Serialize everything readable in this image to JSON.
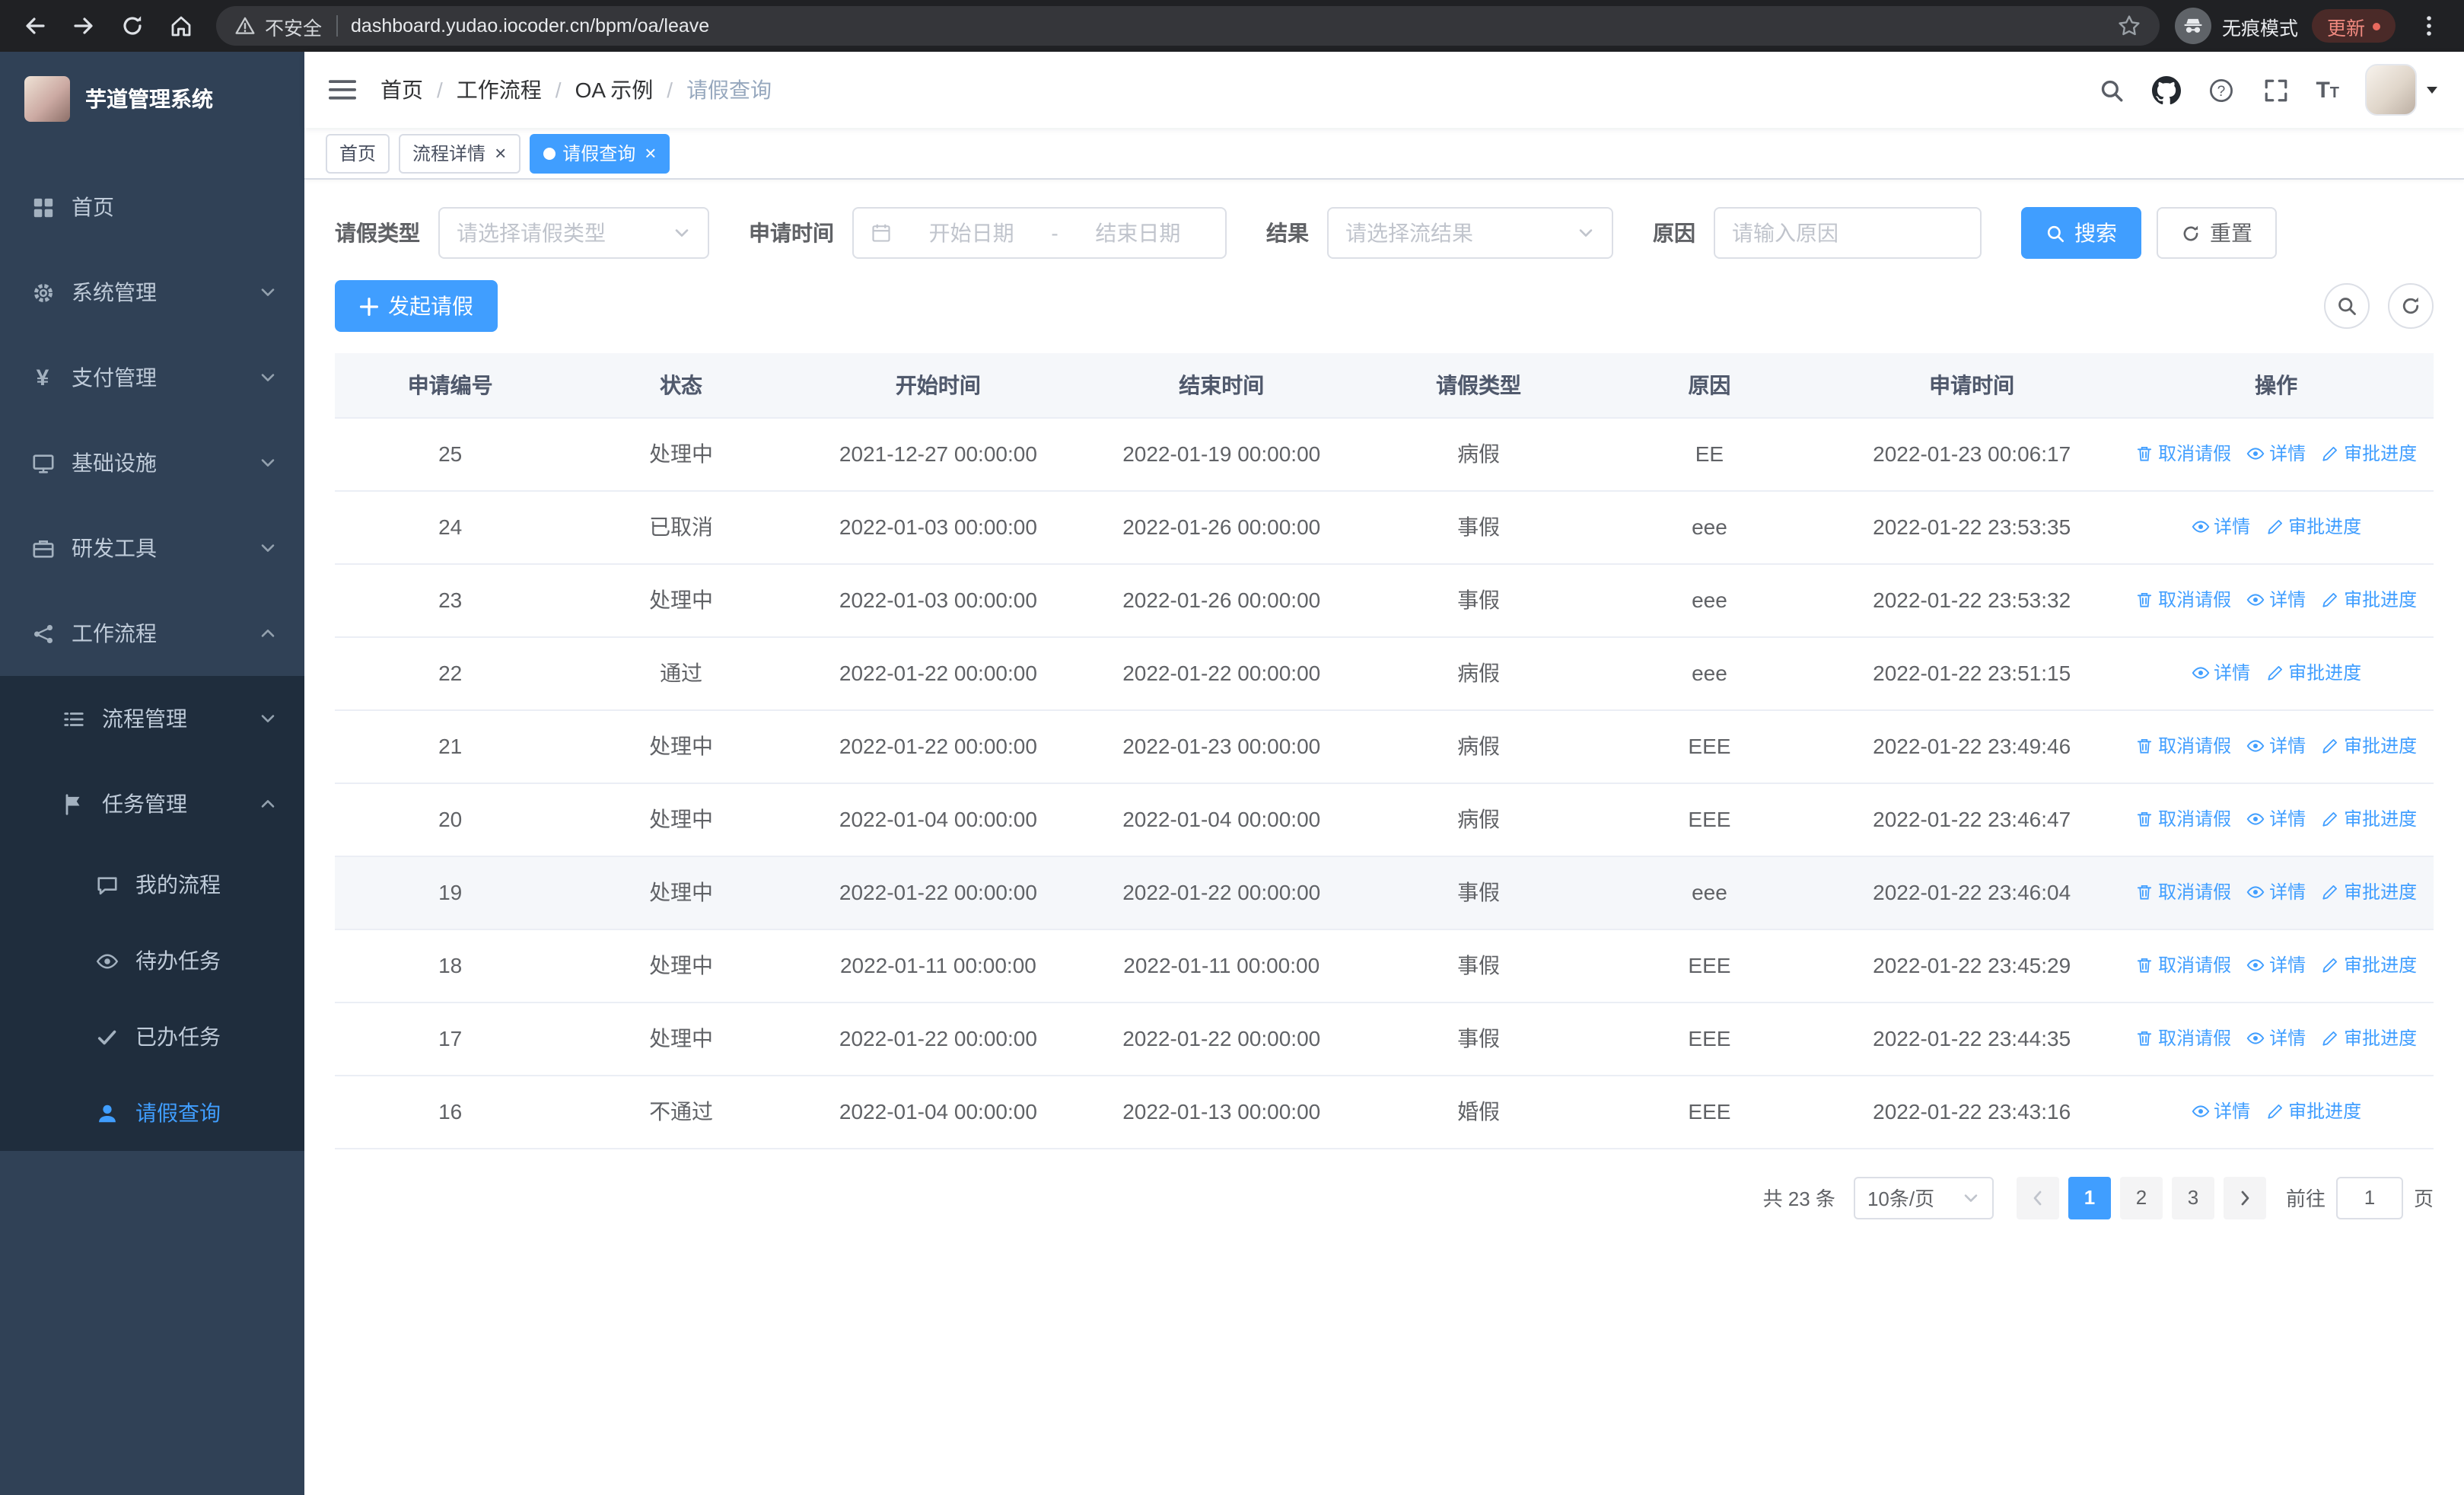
{
  "browser": {
    "security_label": "不安全",
    "url": "dashboard.yudao.iocoder.cn/bpm/oa/leave",
    "incognito_label": "无痕模式",
    "update_label": "更新"
  },
  "sidebar": {
    "logo_title": "芋道管理系统",
    "menu": [
      {
        "label": "首页",
        "icon": "dashboard",
        "level": 1
      },
      {
        "label": "系统管理",
        "icon": "gear",
        "level": 1,
        "arrow": "down"
      },
      {
        "label": "支付管理",
        "icon": "yen",
        "level": 1,
        "arrow": "down"
      },
      {
        "label": "基础设施",
        "icon": "monitor",
        "level": 1,
        "arrow": "down"
      },
      {
        "label": "研发工具",
        "icon": "tools",
        "level": 1,
        "arrow": "down"
      },
      {
        "label": "工作流程",
        "icon": "workflow",
        "level": 1,
        "arrow": "up"
      },
      {
        "label": "流程管理",
        "icon": "list",
        "level": 2,
        "arrow": "down"
      },
      {
        "label": "任务管理",
        "icon": "task",
        "level": 2,
        "arrow": "up"
      },
      {
        "label": "我的流程",
        "icon": "chat",
        "level": 3
      },
      {
        "label": "待办任务",
        "icon": "eye",
        "level": 3
      },
      {
        "label": "已办任务",
        "icon": "done",
        "level": 3
      },
      {
        "label": "请假查询",
        "icon": "user",
        "level": 3,
        "active": true
      }
    ]
  },
  "header": {
    "breadcrumb": [
      "首页",
      "工作流程",
      "OA 示例",
      "请假查询"
    ]
  },
  "tabs": [
    {
      "label": "首页",
      "closable": false,
      "active": false
    },
    {
      "label": "流程详情",
      "closable": true,
      "active": false
    },
    {
      "label": "请假查询",
      "closable": true,
      "active": true
    }
  ],
  "filters": {
    "leave_type_label": "请假类型",
    "leave_type_placeholder": "请选择请假类型",
    "apply_time_label": "申请时间",
    "date_start_placeholder": "开始日期",
    "date_separator": "-",
    "date_end_placeholder": "结束日期",
    "result_label": "结果",
    "result_placeholder": "请选择流结果",
    "reason_label": "原因",
    "reason_placeholder": "请输入原因",
    "search_label": "搜索",
    "reset_label": "重置"
  },
  "toolbar": {
    "create_label": "发起请假"
  },
  "table": {
    "headers": [
      "申请编号",
      "状态",
      "开始时间",
      "结束时间",
      "请假类型",
      "原因",
      "申请时间",
      "操作"
    ],
    "action_labels": {
      "cancel": "取消请假",
      "detail": "详情",
      "progress": "审批进度"
    },
    "rows": [
      {
        "id": "25",
        "status": "处理中",
        "start_time": "2021-12-27 00:00:00",
        "end_time": "2022-01-19 00:00:00",
        "leave_type": "病假",
        "reason": "EE",
        "apply_time": "2022-01-23 00:06:17",
        "ops": [
          "cancel",
          "detail",
          "progress"
        ]
      },
      {
        "id": "24",
        "status": "已取消",
        "start_time": "2022-01-03 00:00:00",
        "end_time": "2022-01-26 00:00:00",
        "leave_type": "事假",
        "reason": "eee",
        "apply_time": "2022-01-22 23:53:35",
        "ops": [
          "detail",
          "progress"
        ]
      },
      {
        "id": "23",
        "status": "处理中",
        "start_time": "2022-01-03 00:00:00",
        "end_time": "2022-01-26 00:00:00",
        "leave_type": "事假",
        "reason": "eee",
        "apply_time": "2022-01-22 23:53:32",
        "ops": [
          "cancel",
          "detail",
          "progress"
        ]
      },
      {
        "id": "22",
        "status": "通过",
        "start_time": "2022-01-22 00:00:00",
        "end_time": "2022-01-22 00:00:00",
        "leave_type": "病假",
        "reason": "eee",
        "apply_time": "2022-01-22 23:51:15",
        "ops": [
          "detail",
          "progress"
        ]
      },
      {
        "id": "21",
        "status": "处理中",
        "start_time": "2022-01-22 00:00:00",
        "end_time": "2022-01-23 00:00:00",
        "leave_type": "病假",
        "reason": "EEE",
        "apply_time": "2022-01-22 23:49:46",
        "ops": [
          "cancel",
          "detail",
          "progress"
        ]
      },
      {
        "id": "20",
        "status": "处理中",
        "start_time": "2022-01-04 00:00:00",
        "end_time": "2022-01-04 00:00:00",
        "leave_type": "病假",
        "reason": "EEE",
        "apply_time": "2022-01-22 23:46:47",
        "ops": [
          "cancel",
          "detail",
          "progress"
        ]
      },
      {
        "id": "19",
        "status": "处理中",
        "start_time": "2022-01-22 00:00:00",
        "end_time": "2022-01-22 00:00:00",
        "leave_type": "事假",
        "reason": "eee",
        "apply_time": "2022-01-22 23:46:04",
        "ops": [
          "cancel",
          "detail",
          "progress"
        ],
        "highlight": true
      },
      {
        "id": "18",
        "status": "处理中",
        "start_time": "2022-01-11 00:00:00",
        "end_time": "2022-01-11 00:00:00",
        "leave_type": "事假",
        "reason": "EEE",
        "apply_time": "2022-01-22 23:45:29",
        "ops": [
          "cancel",
          "detail",
          "progress"
        ]
      },
      {
        "id": "17",
        "status": "处理中",
        "start_time": "2022-01-22 00:00:00",
        "end_time": "2022-01-22 00:00:00",
        "leave_type": "事假",
        "reason": "EEE",
        "apply_time": "2022-01-22 23:44:35",
        "ops": [
          "cancel",
          "detail",
          "progress"
        ]
      },
      {
        "id": "16",
        "status": "不通过",
        "start_time": "2022-01-04 00:00:00",
        "end_time": "2022-01-13 00:00:00",
        "leave_type": "婚假",
        "reason": "EEE",
        "apply_time": "2022-01-22 23:43:16",
        "ops": [
          "detail",
          "progress"
        ]
      }
    ]
  },
  "pagination": {
    "total_label": "共 23 条",
    "page_size_label": "10条/页",
    "pages": [
      "1",
      "2",
      "3"
    ],
    "active_page": "1",
    "goto_prefix": "前往",
    "goto_value": "1",
    "goto_suffix": "页"
  },
  "colors": {
    "primary": "#409EFF",
    "sidebar_bg": "#304156",
    "submenu_bg": "#1f2d3d",
    "chrome_bg": "#202124"
  }
}
